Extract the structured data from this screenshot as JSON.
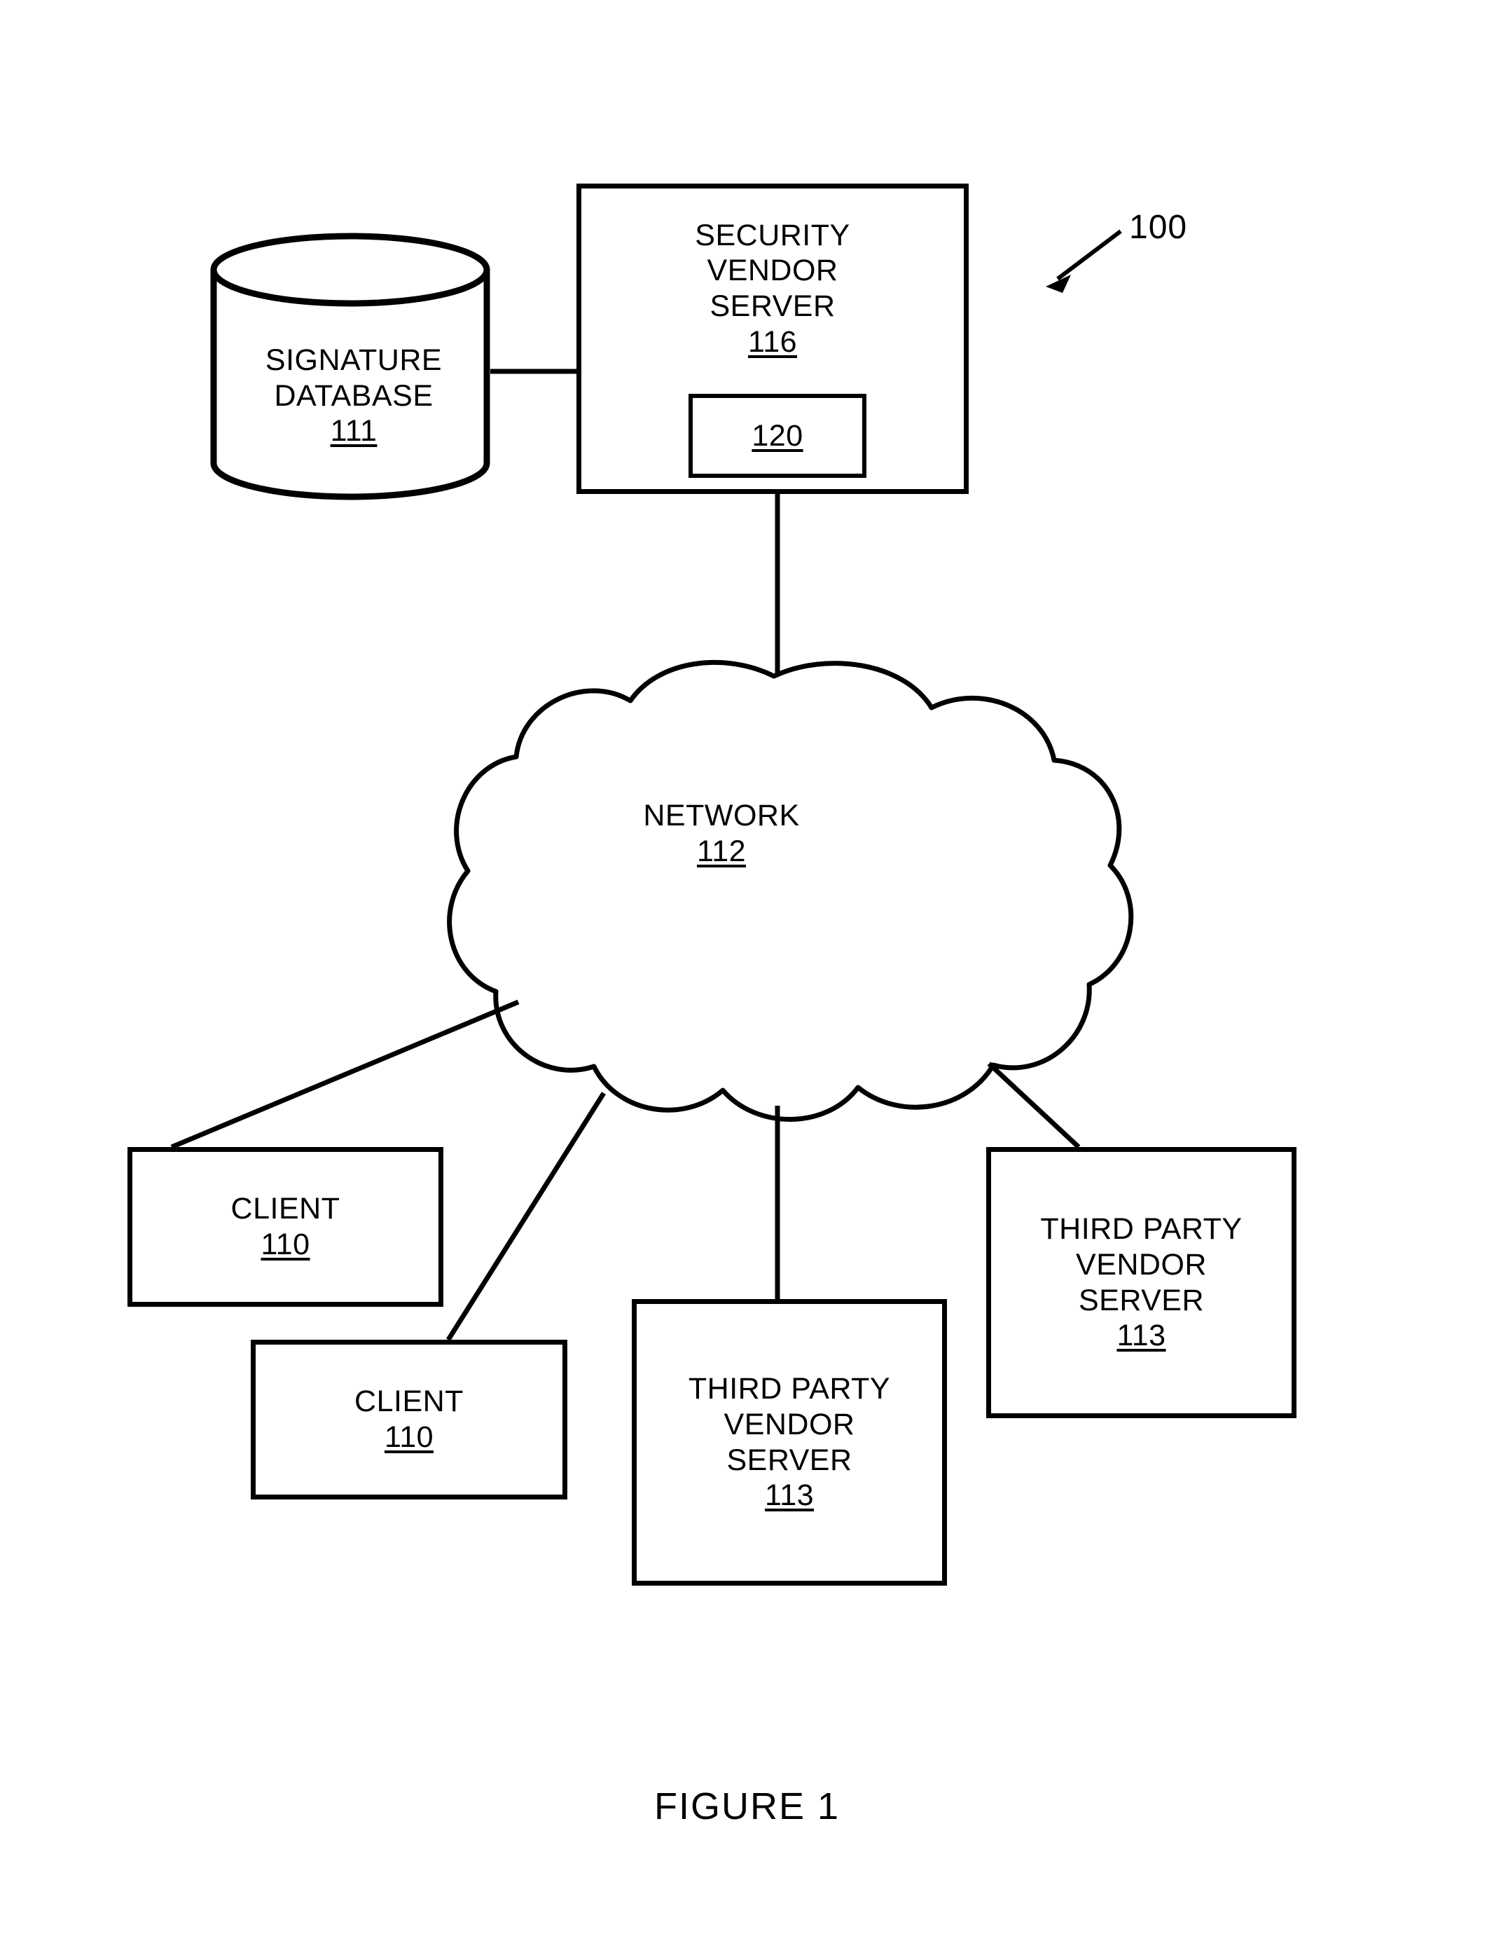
{
  "figure": {
    "caption": "FIGURE 1",
    "system_reference": "100"
  },
  "nodes": {
    "signature_database": {
      "shape": "cylinder",
      "line1": "SIGNATURE",
      "line2": "DATABASE",
      "ref": "111"
    },
    "security_vendor_server": {
      "shape": "rectangle",
      "line1": "SECURITY",
      "line2": "VENDOR",
      "line3": "SERVER",
      "ref": "116",
      "inner_module": {
        "shape": "rectangle",
        "ref": "120"
      }
    },
    "network": {
      "shape": "cloud",
      "line1": "NETWORK",
      "ref": "112"
    },
    "client_1": {
      "shape": "rectangle",
      "line1": "CLIENT",
      "ref": "110"
    },
    "client_2": {
      "shape": "rectangle",
      "line1": "CLIENT",
      "ref": "110"
    },
    "third_party_vendor_server_center": {
      "shape": "rectangle",
      "line1": "THIRD PARTY",
      "line2": "VENDOR",
      "line3": "SERVER",
      "ref": "113"
    },
    "third_party_vendor_server_right": {
      "shape": "rectangle",
      "line1": "THIRD PARTY",
      "line2": "VENDOR",
      "line3": "SERVER",
      "ref": "113"
    }
  },
  "connections": [
    {
      "from": "signature_database",
      "to": "security_vendor_server"
    },
    {
      "from": "security_vendor_server",
      "to": "network"
    },
    {
      "from": "network",
      "to": "client_1"
    },
    {
      "from": "network",
      "to": "client_2"
    },
    {
      "from": "network",
      "to": "third_party_vendor_server_center"
    },
    {
      "from": "network",
      "to": "third_party_vendor_server_right"
    }
  ],
  "colors": {
    "stroke": "#000000",
    "background": "#ffffff"
  }
}
